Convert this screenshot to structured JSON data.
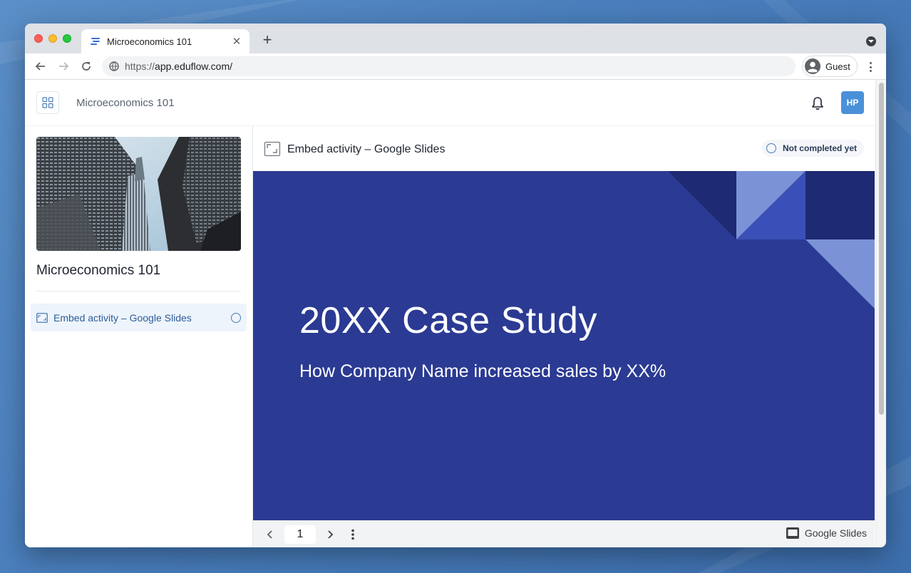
{
  "browser": {
    "tab_title": "Microeconomics 101",
    "url_scheme": "https://",
    "url_host": "app.eduflow.com/",
    "profile_label": "Guest"
  },
  "header": {
    "course_name": "Microeconomics 101",
    "avatar_initials": "HP"
  },
  "sidebar": {
    "course_title": "Microeconomics 101",
    "items": [
      {
        "label": "Embed activity – Google Slides"
      }
    ]
  },
  "main": {
    "activity_title": "Embed activity – Google Slides",
    "completion_status": "Not completed yet"
  },
  "slide": {
    "title": "20XX Case Study",
    "subtitle": "How Company Name increased sales by XX%",
    "background_color": "#2b3a93",
    "page_number": "1",
    "provider_label": "Google Slides"
  },
  "icons": [
    "apps-grid-icon",
    "bell-icon",
    "embed-icon",
    "status-circle-icon",
    "chevron-left-icon",
    "chevron-right-icon",
    "more-vert-icon",
    "google-slides-icon",
    "back-arrow-icon",
    "forward-arrow-icon",
    "reload-icon",
    "site-info-icon",
    "account-icon"
  ]
}
